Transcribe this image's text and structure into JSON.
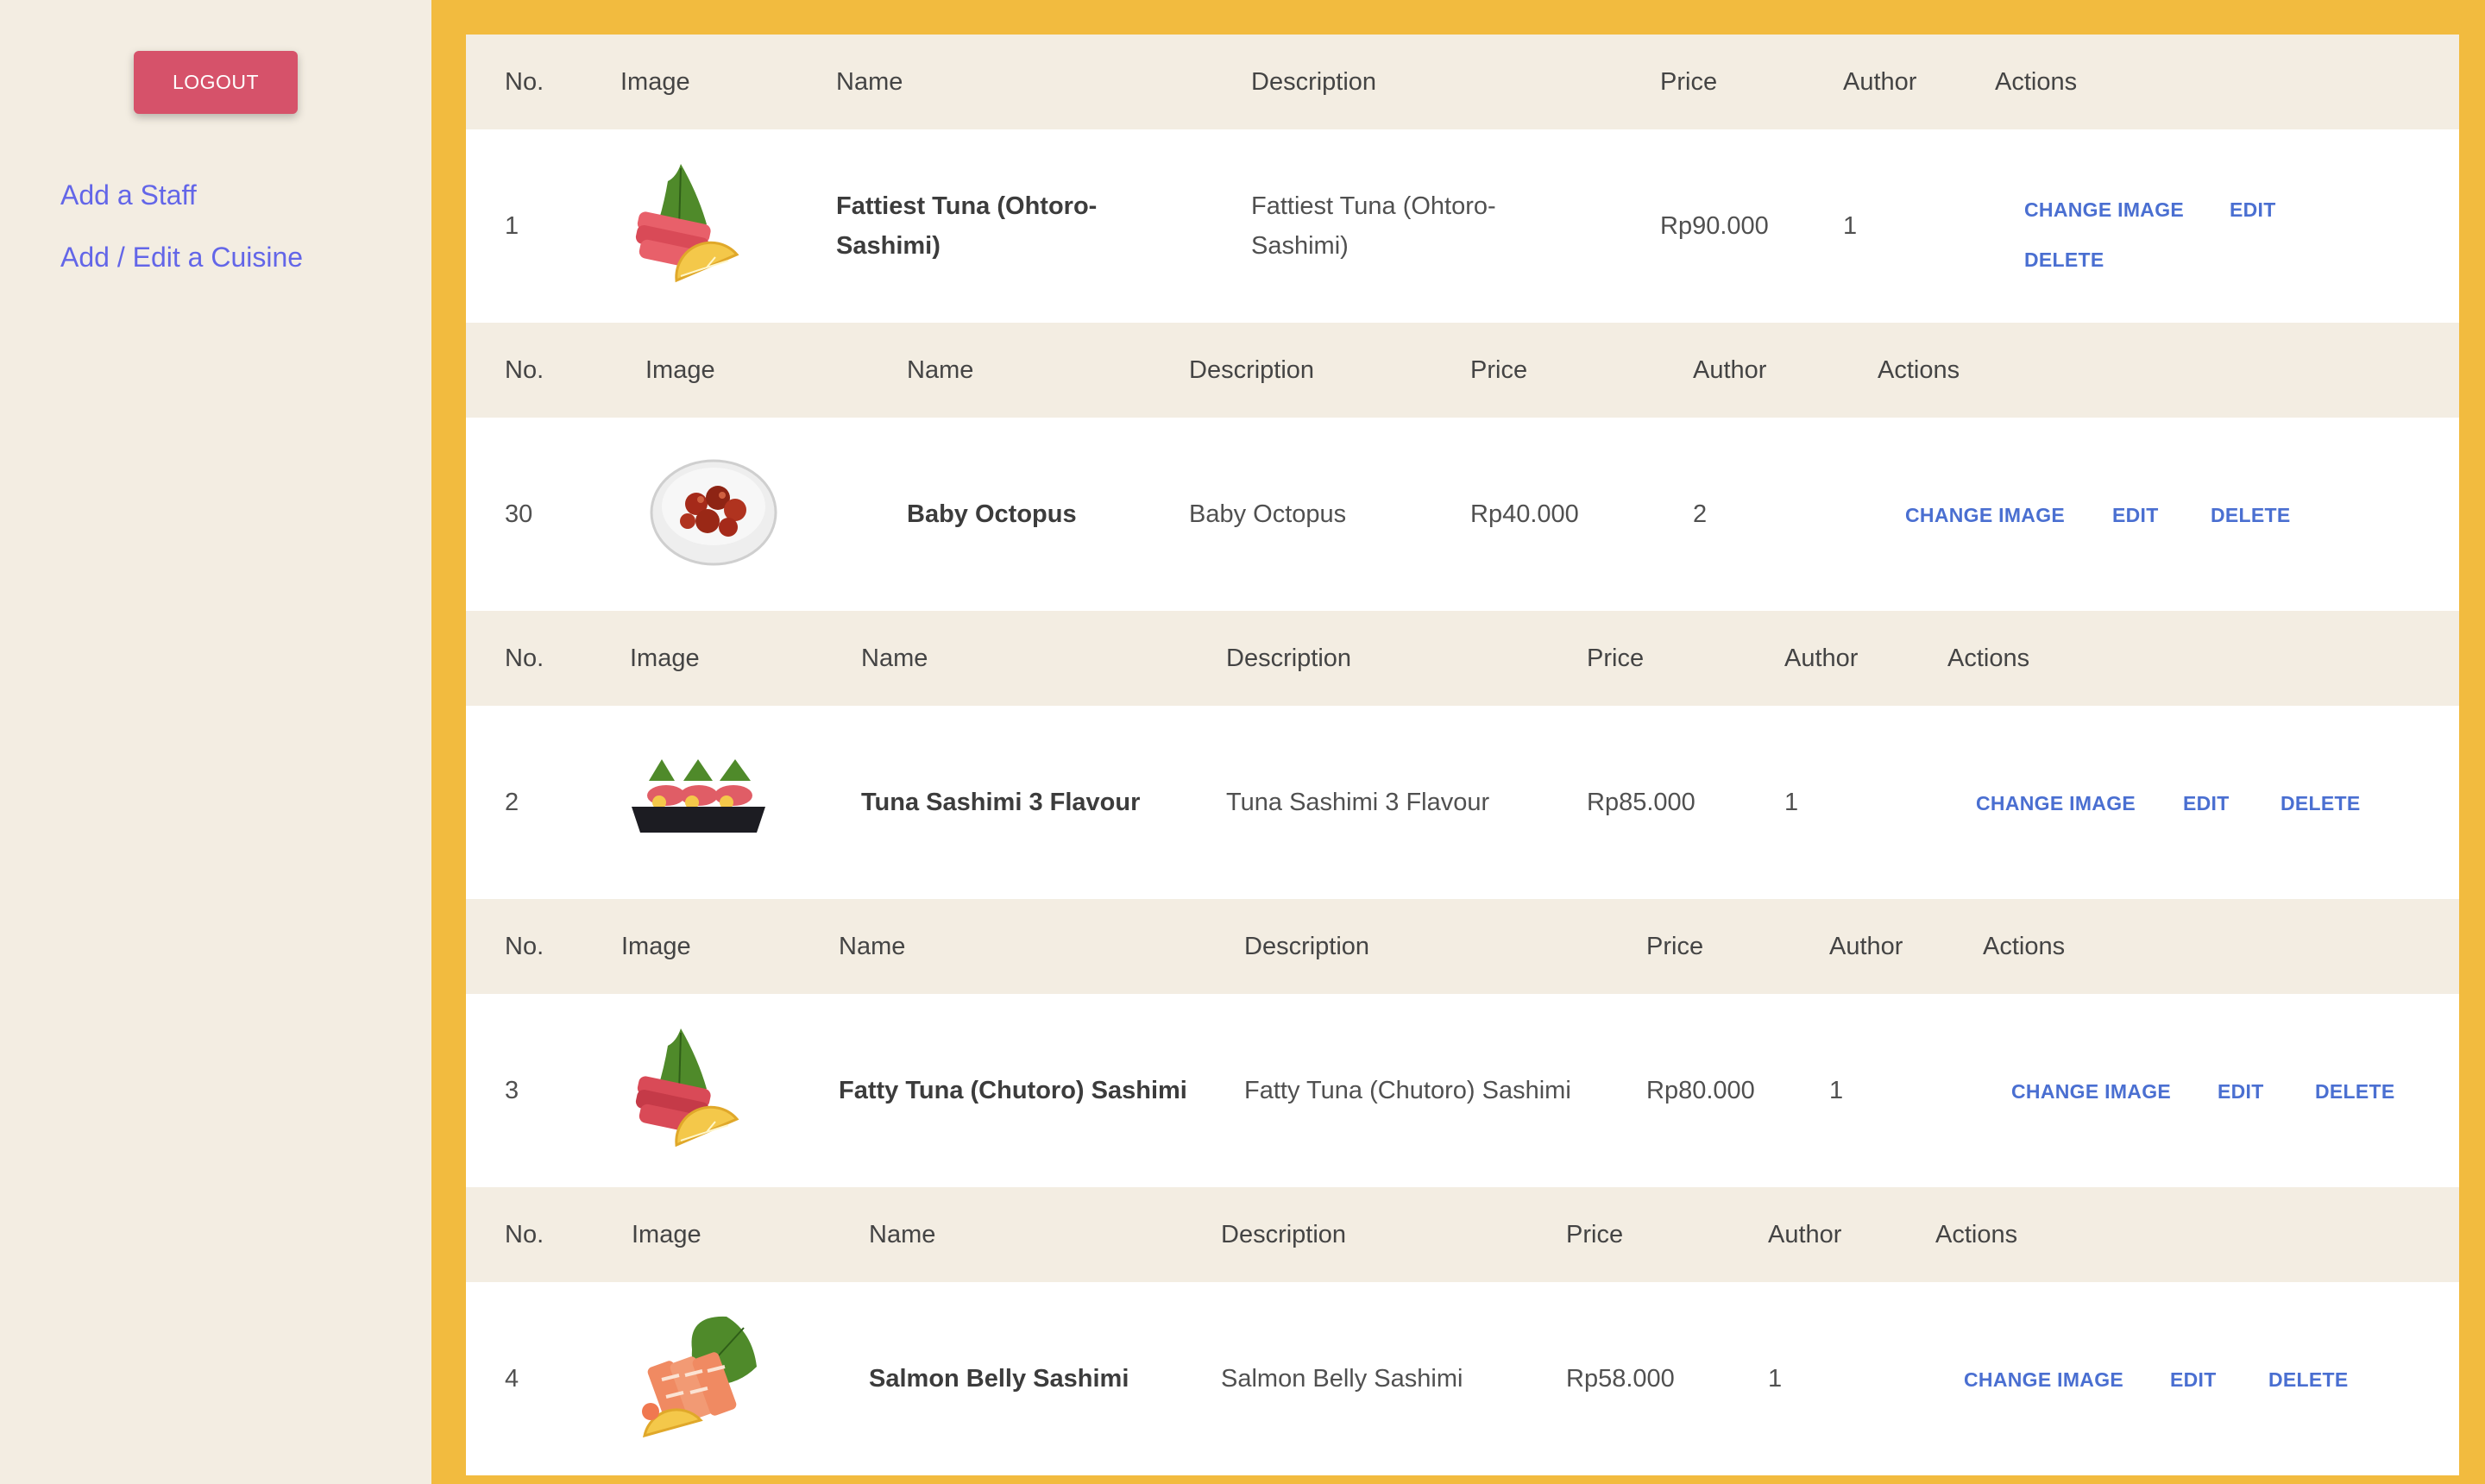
{
  "sidebar": {
    "logout_label": "LOGOUT",
    "links": [
      "Add a Staff",
      "Add / Edit a Cuisine"
    ]
  },
  "table": {
    "headers": [
      "No.",
      "Image",
      "Name",
      "Description",
      "Price",
      "Author",
      "Actions"
    ],
    "actions": [
      "CHANGE IMAGE",
      "EDIT",
      "DELETE"
    ],
    "rows": [
      {
        "no": "1",
        "name": "Fattiest Tuna (Ohtoro-Sashimi)",
        "description": "Fattiest Tuna (Ohtoro-Sashimi)",
        "price": "Rp90.000",
        "author": "1",
        "image": "tuna-sashimi-plate"
      },
      {
        "no": "30",
        "name": "Baby Octopus",
        "description": "Baby Octopus",
        "price": "Rp40.000",
        "author": "2",
        "image": "baby-octopus-bowl"
      },
      {
        "no": "2",
        "name": "Tuna Sashimi 3 Flavour",
        "description": "Tuna Sashimi 3 Flavour",
        "price": "Rp85.000",
        "author": "1",
        "image": "tuna-sashimi-tray"
      },
      {
        "no": "3",
        "name": "Fatty Tuna (Chutoro) Sashimi",
        "description": "Fatty Tuna (Chutoro) Sashimi",
        "price": "Rp80.000",
        "author": "1",
        "image": "tuna-sashimi-plate"
      },
      {
        "no": "4",
        "name": "Salmon Belly Sashimi",
        "description": "Salmon Belly Sashimi",
        "price": "Rp58.000",
        "author": "1",
        "image": "salmon-sashimi-plate"
      }
    ]
  },
  "colors": {
    "main_bg": "#f2bb3f",
    "sidebar_bg": "#f3ede2",
    "logout_bg": "#d6526a",
    "link": "#6366e8",
    "action": "#4a6fd1"
  }
}
